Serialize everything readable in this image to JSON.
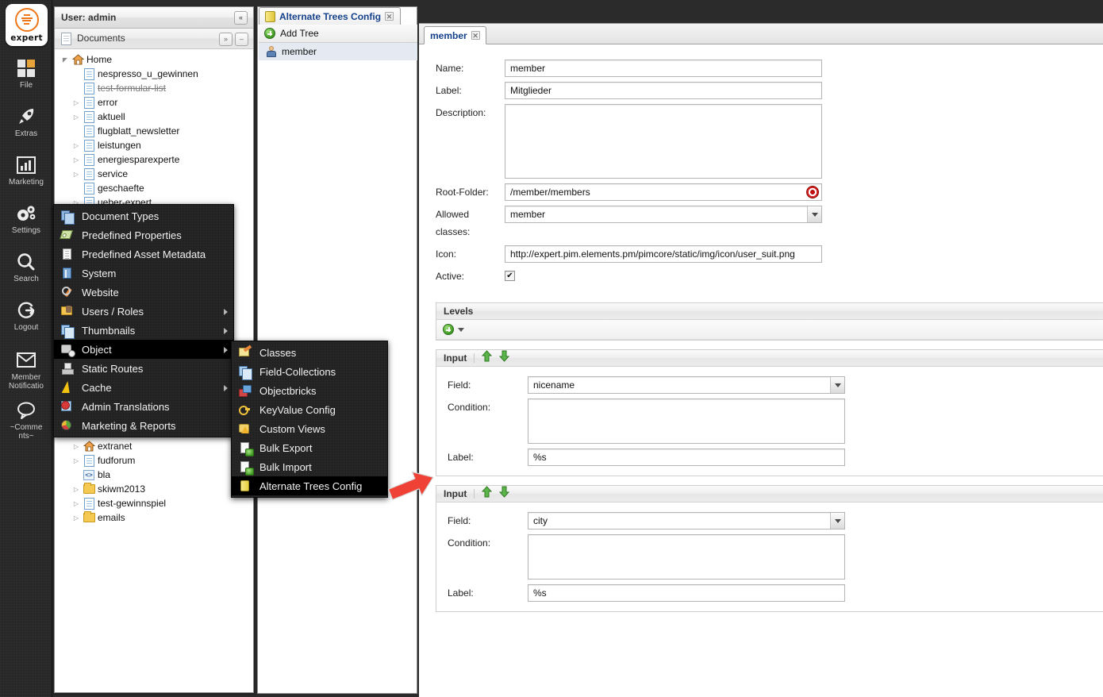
{
  "brand": {
    "wordmark": "expert"
  },
  "rail": {
    "items": [
      {
        "label": "File",
        "icon": "grid-squares-icon"
      },
      {
        "label": "Extras",
        "icon": "rocket-icon"
      },
      {
        "label": "Marketing",
        "icon": "bar-chart-icon"
      },
      {
        "label": "Settings",
        "icon": "gears-icon"
      },
      {
        "label": "Search",
        "icon": "magnifier-icon"
      },
      {
        "label": "Logout",
        "icon": "logout-arrow-icon"
      },
      {
        "label": "Member\nNotificatio",
        "icon": "envelope-icon"
      },
      {
        "label": "~Comme\nnts~",
        "icon": "speech-bubble-icon"
      }
    ]
  },
  "documents_panel": {
    "user_title": "User: admin",
    "collapse_button": "«",
    "section_title": "Documents",
    "expand_button": "»",
    "minimize_button": "–",
    "tree": [
      {
        "label": "Home",
        "icon": "home-icon",
        "depth": 0,
        "expander": "open",
        "strike": false
      },
      {
        "label": "nespresso_u_gewinnen",
        "icon": "page-icon",
        "depth": 1,
        "expander": "none",
        "strike": false
      },
      {
        "label": "test-formular-list",
        "icon": "page-icon",
        "depth": 1,
        "expander": "none",
        "strike": true
      },
      {
        "label": "error",
        "icon": "page-icon",
        "depth": 1,
        "expander": "closed",
        "strike": false
      },
      {
        "label": "aktuell",
        "icon": "page-icon",
        "depth": 1,
        "expander": "closed",
        "strike": false
      },
      {
        "label": "flugblatt_newsletter",
        "icon": "page-icon",
        "depth": 1,
        "expander": "none",
        "strike": false
      },
      {
        "label": "leistungen",
        "icon": "page-icon",
        "depth": 1,
        "expander": "closed",
        "strike": false
      },
      {
        "label": "energiesparexperte",
        "icon": "page-icon",
        "depth": 1,
        "expander": "closed",
        "strike": false
      },
      {
        "label": "service",
        "icon": "page-icon",
        "depth": 1,
        "expander": "closed",
        "strike": false
      },
      {
        "label": "geschaefte",
        "icon": "page-icon",
        "depth": 1,
        "expander": "none",
        "strike": false
      },
      {
        "label": "ueber-expert",
        "icon": "page-icon",
        "depth": 1,
        "expander": "closed",
        "strike": false
      }
    ],
    "tree_lower": [
      {
        "label": "extranet",
        "icon": "home-icon",
        "depth": 1,
        "expander": "closed",
        "strike": false
      },
      {
        "label": "fudforum",
        "icon": "page-icon",
        "depth": 1,
        "expander": "closed",
        "strike": false
      },
      {
        "label": "bla",
        "icon": "snippet-icon",
        "depth": 1,
        "expander": "none",
        "strike": false
      },
      {
        "label": "skiwm2013",
        "icon": "folder-icon",
        "depth": 1,
        "expander": "closed",
        "strike": false
      },
      {
        "label": "test-gewinnspiel",
        "icon": "page-icon",
        "depth": 1,
        "expander": "closed",
        "strike": false
      },
      {
        "label": "emails",
        "icon": "folder-icon",
        "depth": 1,
        "expander": "closed",
        "strike": false
      }
    ]
  },
  "trees_panel": {
    "tab_label": "Alternate Trees Config",
    "tab_icon": "yellow-cylinder-icon",
    "tab_close": "✕",
    "add_tree_label": "Add Tree",
    "items": [
      {
        "label": "member",
        "icon": "user-suit-icon",
        "selected": true
      }
    ]
  },
  "editor": {
    "tab_label": "member",
    "tab_close": "✕",
    "fields": {
      "name_label": "Name:",
      "name_value": "member",
      "label_label": "Label:",
      "label_value": "Mitglieder",
      "description_label": "Description:",
      "description_value": "",
      "root_folder_label": "Root-Folder:",
      "root_folder_value": "/member/members",
      "allowed_classes_label": "Allowed classes:",
      "allowed_classes_value": "member",
      "icon_label": "Icon:",
      "icon_value": "http://expert.pim.elements.pm/pimcore/static/img/icon/user_suit.png",
      "active_label": "Active:",
      "active_checked": true,
      "checkmark": "✔"
    },
    "levels": {
      "title": "Levels",
      "add_icon": "green-plus-icon",
      "panels": [
        {
          "title": "Input",
          "move_up_icon": "arrow-up-icon",
          "move_down_icon": "arrow-down-icon",
          "field_label": "Field:",
          "field_value": "nicename",
          "condition_label": "Condition:",
          "condition_value": "",
          "label_label": "Label:",
          "label_value": "%s"
        },
        {
          "title": "Input",
          "move_up_icon": "arrow-up-icon",
          "move_down_icon": "arrow-down-icon",
          "field_label": "Field:",
          "field_value": "city",
          "condition_label": "Condition:",
          "condition_value": "",
          "label_label": "Label:",
          "label_value": "%s"
        }
      ]
    }
  },
  "context_menu": {
    "items": [
      {
        "label": "Document Types",
        "icon": "document-types-icon",
        "submenu": false,
        "selected": false
      },
      {
        "label": "Predefined Properties",
        "icon": "tag-icon",
        "submenu": false,
        "selected": false
      },
      {
        "label": "Predefined Asset Metadata",
        "icon": "asset-metadata-icon",
        "submenu": false,
        "selected": false
      },
      {
        "label": "System",
        "icon": "system-icon",
        "submenu": false,
        "selected": false
      },
      {
        "label": "Website",
        "icon": "wrench-icon",
        "submenu": false,
        "selected": false
      },
      {
        "label": "Users / Roles",
        "icon": "users-roles-icon",
        "submenu": true,
        "selected": false
      },
      {
        "label": "Thumbnails",
        "icon": "thumbnails-icon",
        "submenu": true,
        "selected": false
      },
      {
        "label": "Object",
        "icon": "object-icon",
        "submenu": true,
        "selected": true
      },
      {
        "label": "Static Routes",
        "icon": "static-routes-icon",
        "submenu": false,
        "selected": false
      },
      {
        "label": "Cache",
        "icon": "lightning-icon",
        "submenu": true,
        "selected": false
      },
      {
        "label": "Admin Translations",
        "icon": "translations-icon",
        "submenu": false,
        "selected": false
      },
      {
        "label": "Marketing & Reports",
        "icon": "reports-pie-icon",
        "submenu": false,
        "selected": false
      }
    ]
  },
  "context_submenu": {
    "items": [
      {
        "label": "Classes",
        "icon": "classes-icon",
        "selected": false
      },
      {
        "label": "Field-Collections",
        "icon": "field-collections-icon",
        "selected": false
      },
      {
        "label": "Objectbricks",
        "icon": "objectbricks-icon",
        "selected": false
      },
      {
        "label": "KeyValue Config",
        "icon": "key-icon",
        "selected": false
      },
      {
        "label": "Custom Views",
        "icon": "custom-views-icon",
        "selected": false
      },
      {
        "label": "Bulk Export",
        "icon": "bulk-export-icon",
        "selected": false
      },
      {
        "label": "Bulk Import",
        "icon": "bulk-import-icon",
        "selected": false
      },
      {
        "label": "Alternate Trees Config",
        "icon": "yellow-cylinder-icon",
        "selected": true
      }
    ]
  },
  "annotation": {
    "arrow_color": "#ef4136",
    "arrow_name": "red-pointer-arrow"
  }
}
